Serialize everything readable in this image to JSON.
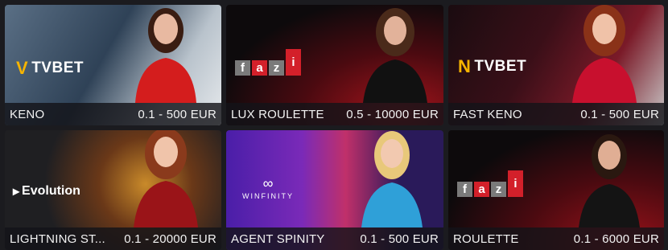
{
  "games": [
    {
      "name": "KENO",
      "limits": "0.1 - 500 EUR",
      "provider": "TVBET",
      "logo_icon": "tvbet-logo-icon",
      "bg": "#2b3a4a",
      "accent": "#c51616"
    },
    {
      "name": "LUX ROULETTE",
      "limits": "0.5 - 10000 EUR",
      "provider_letters": [
        "f",
        "a",
        "z",
        "i"
      ],
      "logo_icon": "fazi-logo-icon",
      "bg": "#1a0d10",
      "accent": "#8a1019"
    },
    {
      "name": "FAST KENO",
      "limits": "0.1 - 500 EUR",
      "provider": "TVBET",
      "logo_icon": "tvbet-logo-icon",
      "bg": "#3a1018",
      "accent": "#b01428"
    },
    {
      "name": "LIGHTNING ST...",
      "limits": "0.1 - 20000 EUR",
      "provider": "Evolution",
      "logo_icon": "evolution-logo-icon",
      "bg": "#3a2a14",
      "accent": "#9a2018"
    },
    {
      "name": "AGENT SPINITY",
      "limits": "0.1 - 500 EUR",
      "provider": "WINFINITY",
      "logo_icon": "winfinity-logo-icon",
      "bg": "#2a1a5a",
      "accent": "#1f7fd0"
    },
    {
      "name": "ROULETTE",
      "limits": "0.1 - 6000 EUR",
      "provider_letters": [
        "f",
        "a",
        "z",
        "i"
      ],
      "logo_icon": "fazi-logo-icon",
      "bg": "#1c0a0c",
      "accent": "#7a0f17"
    }
  ]
}
